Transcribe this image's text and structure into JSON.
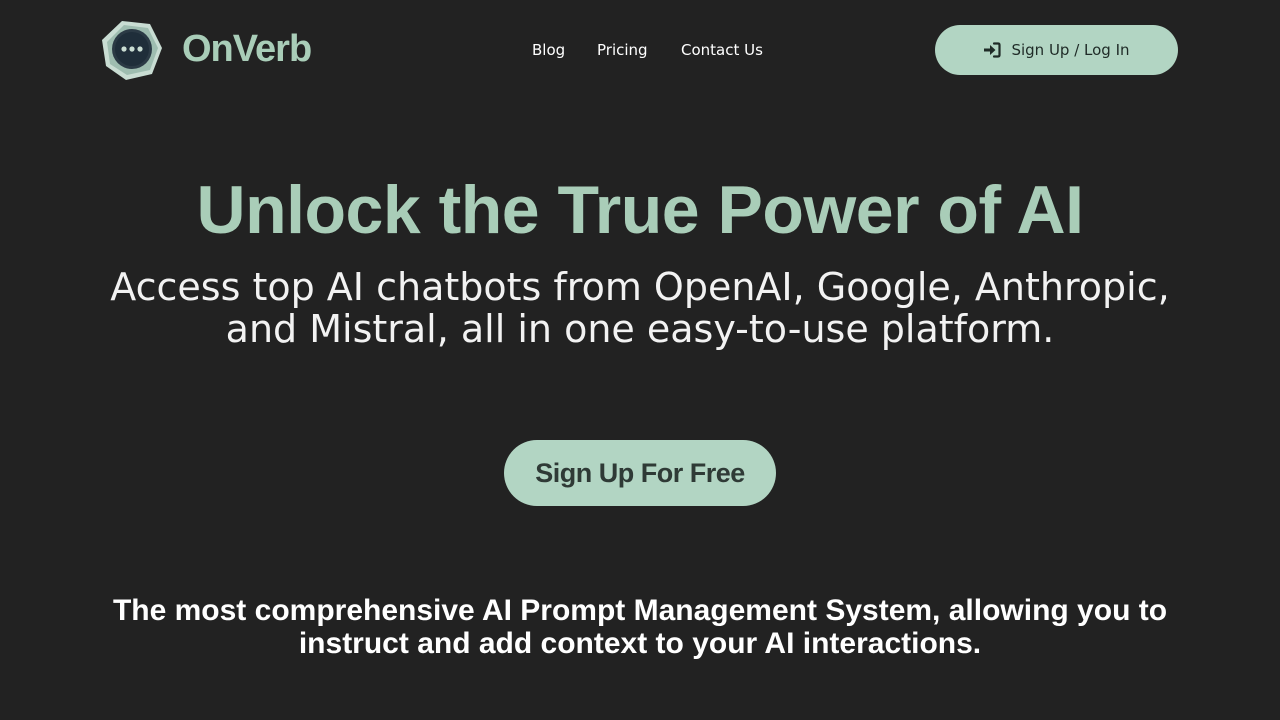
{
  "brand": {
    "name": "OnVerb",
    "logo_icon": "chat-bubble-dots-icon",
    "accent_color": "#a9cdb8",
    "button_color": "#b2d5c3",
    "background_color": "#222222"
  },
  "nav": {
    "items": [
      {
        "label": "Blog"
      },
      {
        "label": "Pricing"
      },
      {
        "label": "Contact Us"
      }
    ]
  },
  "header": {
    "signin_label": "Sign Up / Log In",
    "signin_icon": "sign-in-arrow-icon"
  },
  "hero": {
    "title": "Unlock the True Power of AI",
    "subtitle": "Access top AI chatbots from OpenAI, Google, Anthropic, and Mistral, all in one easy-to-use platform.",
    "cta_label": "Sign Up For Free"
  },
  "tagline": {
    "text": "The most comprehensive AI Prompt Management System, allowing you to instruct and add context to your AI interactions."
  }
}
